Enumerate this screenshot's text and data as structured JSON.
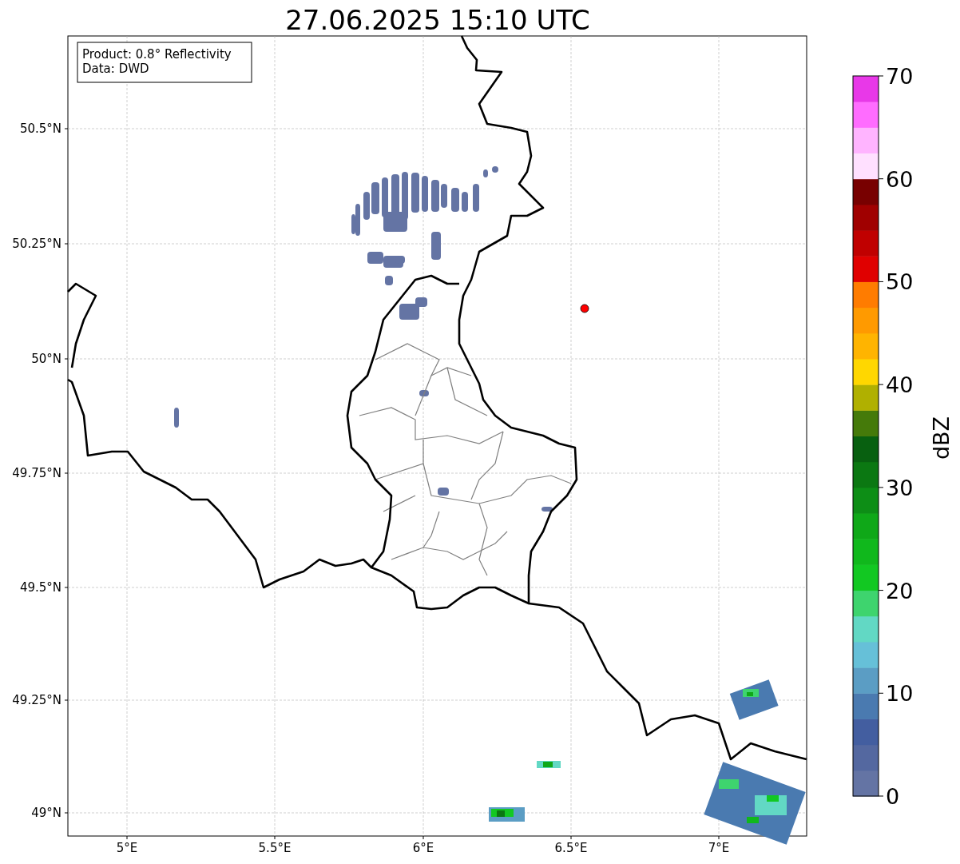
{
  "title": "27.06.2025 15:10 UTC",
  "info_box": [
    "Product: 0.8° Reflectivity",
    "Data: DWD"
  ],
  "map": {
    "xticks": [
      "5°E",
      "5.5°E",
      "6°E",
      "6.5°E",
      "7°E"
    ],
    "yticks": [
      "50.5°N",
      "50.25°N",
      "50°N",
      "49.75°N",
      "49.5°N",
      "49.25°N",
      "49°N"
    ]
  },
  "colorbar": {
    "label": "dBZ",
    "ticks": [
      "70",
      "60",
      "50",
      "40",
      "30",
      "20",
      "10",
      "0"
    ],
    "bins": [
      {
        "color": "#6474a4"
      },
      {
        "color": "#5468a0"
      },
      {
        "color": "#435ea0"
      },
      {
        "color": "#4a7ab0"
      },
      {
        "color": "#5b9dc4"
      },
      {
        "color": "#66c0d8"
      },
      {
        "color": "#62d8c4"
      },
      {
        "color": "#3ed46e"
      },
      {
        "color": "#12c822"
      },
      {
        "color": "#10b81c"
      },
      {
        "color": "#0fa818"
      },
      {
        "color": "#0d8e16"
      },
      {
        "color": "#0b7812"
      },
      {
        "color": "#086010"
      },
      {
        "color": "#457a0a"
      },
      {
        "color": "#b0b000"
      },
      {
        "color": "#ffd700"
      },
      {
        "color": "#ffb400"
      },
      {
        "color": "#ff9a00"
      },
      {
        "color": "#ff7c00"
      },
      {
        "color": "#e00000"
      },
      {
        "color": "#c00000"
      },
      {
        "color": "#a00000"
      },
      {
        "color": "#780000"
      },
      {
        "color": "#ffe0ff"
      },
      {
        "color": "#ffb4ff"
      },
      {
        "color": "#ff6cff"
      },
      {
        "color": "#e838e8"
      }
    ]
  }
}
